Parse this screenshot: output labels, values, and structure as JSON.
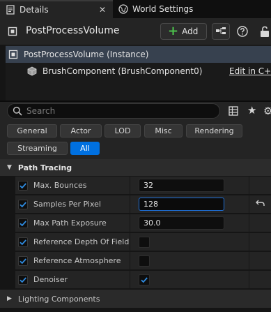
{
  "tabs": [
    {
      "label": "Details",
      "icon": "details-icon",
      "active": true
    },
    {
      "label": "World Settings",
      "icon": "globe-icon",
      "active": false
    }
  ],
  "header": {
    "actor_name": "PostProcessVolume",
    "add_label": "Add"
  },
  "tree": {
    "root_label": "PostProcessVolume (Instance)",
    "child_label": "BrushComponent (BrushComponent0)",
    "edit_link": "Edit in C++"
  },
  "search": {
    "placeholder": "Search",
    "value": ""
  },
  "filters": [
    "General",
    "Actor",
    "LOD",
    "Misc",
    "Rendering",
    "Streaming",
    "All"
  ],
  "selected_filter": "All",
  "category": {
    "label": "Path Tracing",
    "expanded": true
  },
  "properties": [
    {
      "name": "Max. Bounces",
      "overridden": true,
      "value": "32",
      "type": "number"
    },
    {
      "name": "Samples Per Pixel",
      "overridden": true,
      "value": "128",
      "type": "number",
      "editing": true,
      "resettable": true
    },
    {
      "name": "Max Path Exposure",
      "overridden": true,
      "value": "30.0",
      "type": "number"
    },
    {
      "name": "Reference Depth Of Field",
      "overridden": true,
      "value": false,
      "type": "bool"
    },
    {
      "name": "Reference Atmosphere",
      "overridden": true,
      "value": false,
      "type": "bool"
    },
    {
      "name": "Denoiser",
      "overridden": true,
      "value": true,
      "type": "bool"
    }
  ],
  "next_category": {
    "label": "Lighting Components",
    "expanded": false
  },
  "colors": {
    "accent": "#0070e0",
    "add_plus": "#4cc24c",
    "check": "#2f8de4",
    "selection_row": "#37414f"
  }
}
